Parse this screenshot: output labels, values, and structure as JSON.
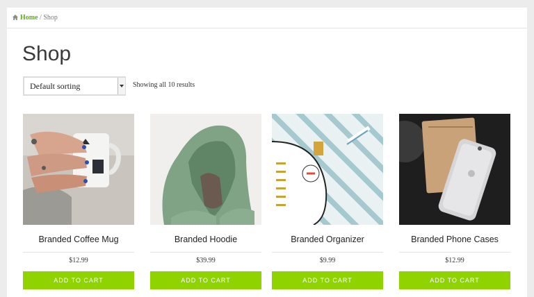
{
  "breadcrumb": {
    "home": "Home",
    "separator": "/",
    "current": "Shop"
  },
  "page": {
    "title": "Shop"
  },
  "sorting": {
    "selected": "Default sorting"
  },
  "results": {
    "text": "Showing all 10 results"
  },
  "products": [
    {
      "name": "Branded Coffee Mug",
      "price": "$12.99",
      "button": "ADD TO CART"
    },
    {
      "name": "Branded Hoodie",
      "price": "$39.99",
      "button": "ADD TO CART"
    },
    {
      "name": "Branded Organizer",
      "price": "$9.99",
      "button": "ADD TO CART"
    },
    {
      "name": "Branded Phone Cases",
      "price": "$12.99",
      "button": "ADD TO CART"
    }
  ],
  "colors": {
    "accent": "#8fd400",
    "link": "#5fae1a",
    "background": "#ececec"
  },
  "icons": {
    "home": "home-icon",
    "dropdown": "chevron-down-icon"
  }
}
